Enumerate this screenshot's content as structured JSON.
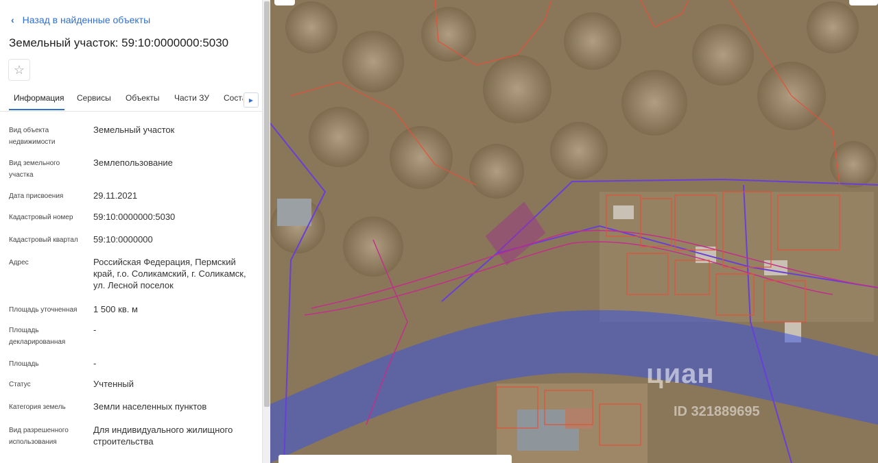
{
  "header": {
    "back_label": "Назад в найденные объекты",
    "title": "Земельный участок: 59:10:0000000:5030"
  },
  "tabs": [
    {
      "label": "Информация",
      "active": true
    },
    {
      "label": "Сервисы"
    },
    {
      "label": "Объекты"
    },
    {
      "label": "Части ЗУ"
    },
    {
      "label": "Соста"
    }
  ],
  "fields": [
    {
      "label": "Вид объекта недвижимости",
      "value": "Земельный участок"
    },
    {
      "label": "Вид земельного участка",
      "value": "Землепользование"
    },
    {
      "label": "Дата присвоения",
      "value": "29.11.2021"
    },
    {
      "label": "Кадастровый номер",
      "value": "59:10:0000000:5030"
    },
    {
      "label": "Кадастровый квартал",
      "value": "59:10:0000000"
    },
    {
      "label": "Адрес",
      "value": "Российская Федерация, Пермский край, г.о. Соликамский, г. Соликамск, ул. Лесной поселок"
    },
    {
      "label": "Площадь уточненная",
      "value": "1 500 кв. м"
    },
    {
      "label": "Площадь декларированная",
      "value": "-"
    },
    {
      "label": "Площадь",
      "value": "-"
    },
    {
      "label": "Статус",
      "value": "Учтенный"
    },
    {
      "label": "Категория земель",
      "value": "Земли населенных пунктов"
    },
    {
      "label": "Вид разрешенного использования",
      "value": "Для индивидуального жилищного строительства"
    }
  ],
  "map": {
    "watermark": "циан",
    "watermark_id": "ID 321889695",
    "colors": {
      "parcel": "#e2523a",
      "zone": "#6a3fd6",
      "water_zone": "#3b56e0",
      "selected": "#a0308f"
    }
  },
  "icons": {
    "back": "chevron-left-icon",
    "favorite": "star-icon",
    "more_tabs": "triangle-right-icon"
  }
}
